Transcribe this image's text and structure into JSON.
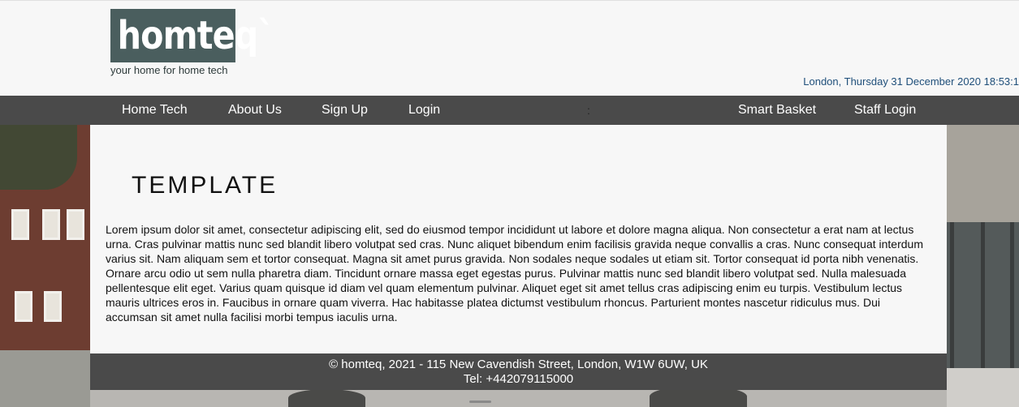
{
  "brand": {
    "logo_text": "homteq`",
    "tagline": "your home for home tech"
  },
  "header": {
    "datetime": "London, Thursday 31 December 2020 18:53:1"
  },
  "nav": {
    "items": [
      {
        "label": "Home Tech"
      },
      {
        "label": "About Us"
      },
      {
        "label": "Sign Up"
      },
      {
        "label": "Login"
      }
    ],
    "separator": ":",
    "right_items": [
      {
        "label": "Smart Basket"
      },
      {
        "label": "Staff Login"
      }
    ]
  },
  "main": {
    "title": "TEMPLATE",
    "body": "Lorem ipsum dolor sit amet, consectetur adipiscing elit, sed do eiusmod tempor incididunt ut labore et dolore magna aliqua. Non consectetur a erat nam at lectus urna. Cras pulvinar mattis nunc sed blandit libero volutpat sed cras. Nunc aliquet bibendum enim facilisis gravida neque convallis a cras. Nunc consequat interdum varius sit. Nam aliquam sem et tortor consequat. Magna sit amet purus gravida. Non sodales neque sodales ut etiam sit. Tortor consequat id porta nibh venenatis. Ornare arcu odio ut sem nulla pharetra diam. Tincidunt ornare massa eget egestas purus. Pulvinar mattis nunc sed blandit libero volutpat sed. Nulla malesuada pellentesque elit eget. Varius quam quisque id diam vel quam elementum pulvinar. Aliquet eget sit amet tellus cras adipiscing enim eu turpis. Vestibulum lectus mauris ultrices eros in. Faucibus in ornare quam viverra. Hac habitasse platea dictumst vestibulum rhoncus. Parturient montes nascetur ridiculus mus. Dui accumsan sit amet nulla facilisi morbi tempus iaculis urna."
  },
  "footer": {
    "address": "© homteq, 2021 - 115 New Cavendish Street, London, W1W 6UW, UK",
    "phone": "Tel: +442079115000"
  },
  "colors": {
    "logo_bg": "#4a5e5e",
    "nav_bg": "#4a4a4a",
    "datetime": "#1f4f7a",
    "page_bg": "#f7f7f7"
  }
}
